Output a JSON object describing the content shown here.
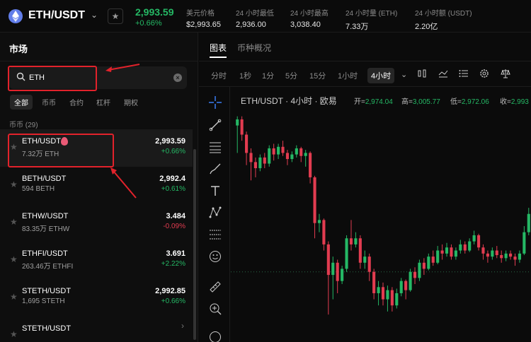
{
  "header": {
    "pair": "ETH/USDT",
    "price": "2,993.59",
    "change": "+0.66%",
    "stats": [
      {
        "label": "美元价格",
        "value": "$2,993.65"
      },
      {
        "label": "24 小时最低",
        "value": "2,936.00"
      },
      {
        "label": "24 小时最高",
        "value": "3,038.40"
      },
      {
        "label": "24 小时量 (ETH)",
        "value": "7.33万"
      },
      {
        "label": "24 小时额 (USDT)",
        "value": "2.20亿"
      }
    ]
  },
  "market": {
    "title": "市场",
    "search": {
      "value": "ETH",
      "placeholder": ""
    },
    "filters": [
      "全部",
      "币币",
      "合约",
      "杠杆",
      "期权"
    ],
    "group_label": "币币 (29)",
    "rows": [
      {
        "symbol": "ETH/USDT",
        "volume": "7.32万 ETH",
        "price": "2,993.59",
        "change": "+0.66%",
        "dir": "up"
      },
      {
        "symbol": "BETH/USDT",
        "volume": "594 BETH",
        "price": "2,992.4",
        "change": "+0.61%",
        "dir": "up"
      },
      {
        "symbol": "ETHW/USDT",
        "volume": "83.35万 ETHW",
        "price": "3.484",
        "change": "-0.09%",
        "dir": "down"
      },
      {
        "symbol": "ETHFI/USDT",
        "volume": "263.46万 ETHFI",
        "price": "3.691",
        "change": "+2.22%",
        "dir": "up"
      },
      {
        "symbol": "STETH/USDT",
        "volume": "1,695 STETH",
        "price": "2,992.85",
        "change": "+0.66%",
        "dir": "up"
      },
      {
        "symbol": "STETH/USDT",
        "volume": "",
        "price": "",
        "change": "",
        "dir": "up"
      }
    ]
  },
  "chart_panel": {
    "tabs": [
      "图表",
      "币种概况"
    ],
    "timeframes": [
      "分时",
      "1秒",
      "1分",
      "5分",
      "15分",
      "1小时",
      "4小时"
    ],
    "active_timeframe": "4小时",
    "title": "ETH/USDT · 4小时 · 欧易",
    "ohlc": {
      "open_label": "开=",
      "open": "2,974.04",
      "high_label": "高=",
      "high": "3,005.77",
      "low_label": "低=",
      "low": "2,972.06",
      "close_label": "收=",
      "close": "2,993"
    }
  },
  "colors": {
    "up": "#25b865",
    "down": "#e23c50",
    "accent": "#e2222b",
    "background": "#0b0b0b"
  },
  "chart_data": {
    "type": "candlestick",
    "series": [
      {
        "o": 3470,
        "c": 3490,
        "h": 3500,
        "l": 3380
      },
      {
        "o": 3490,
        "c": 3440,
        "h": 3500,
        "l": 3420
      },
      {
        "o": 3440,
        "c": 3380,
        "h": 3450,
        "l": 3340
      },
      {
        "o": 3380,
        "c": 3350,
        "h": 3395,
        "l": 3290
      },
      {
        "o": 3350,
        "c": 3330,
        "h": 3365,
        "l": 3300
      },
      {
        "o": 3330,
        "c": 3365,
        "h": 3375,
        "l": 3320
      },
      {
        "o": 3365,
        "c": 3345,
        "h": 3380,
        "l": 3330
      },
      {
        "o": 3345,
        "c": 3395,
        "h": 3405,
        "l": 3335
      },
      {
        "o": 3395,
        "c": 3375,
        "h": 3410,
        "l": 3355
      },
      {
        "o": 3375,
        "c": 3400,
        "h": 3410,
        "l": 3360
      },
      {
        "o": 3400,
        "c": 3380,
        "h": 3420,
        "l": 3370
      },
      {
        "o": 3380,
        "c": 3360,
        "h": 3390,
        "l": 3340
      },
      {
        "o": 3360,
        "c": 3375,
        "h": 3385,
        "l": 3350
      },
      {
        "o": 3375,
        "c": 3395,
        "h": 3405,
        "l": 3365
      },
      {
        "o": 3395,
        "c": 3370,
        "h": 3400,
        "l": 3350
      },
      {
        "o": 3370,
        "c": 3380,
        "h": 3390,
        "l": 3335
      },
      {
        "o": 3380,
        "c": 3300,
        "h": 3385,
        "l": 3280
      },
      {
        "o": 3300,
        "c": 3150,
        "h": 3305,
        "l": 3100
      },
      {
        "o": 3150,
        "c": 3160,
        "h": 3180,
        "l": 3120
      },
      {
        "o": 3160,
        "c": 3080,
        "h": 3165,
        "l": 3060
      },
      {
        "o": 3080,
        "c": 2980,
        "h": 3090,
        "l": 2850
      },
      {
        "o": 2980,
        "c": 3020,
        "h": 3040,
        "l": 2900
      },
      {
        "o": 3020,
        "c": 2960,
        "h": 3030,
        "l": 2920
      },
      {
        "o": 2960,
        "c": 3000,
        "h": 3010,
        "l": 2950
      },
      {
        "o": 3000,
        "c": 3100,
        "h": 3110,
        "l": 2990
      },
      {
        "o": 3100,
        "c": 3080,
        "h": 3160,
        "l": 3060
      },
      {
        "o": 3080,
        "c": 3100,
        "h": 3120,
        "l": 3070
      },
      {
        "o": 3100,
        "c": 3020,
        "h": 3110,
        "l": 3000
      },
      {
        "o": 3020,
        "c": 3040,
        "h": 3060,
        "l": 3000
      },
      {
        "o": 3040,
        "c": 2990,
        "h": 3050,
        "l": 2960
      },
      {
        "o": 2990,
        "c": 2920,
        "h": 3000,
        "l": 2900
      },
      {
        "o": 2920,
        "c": 2940,
        "h": 2960,
        "l": 2880
      },
      {
        "o": 2940,
        "c": 2900,
        "h": 2955,
        "l": 2880
      },
      {
        "o": 2900,
        "c": 2930,
        "h": 2945,
        "l": 2860
      },
      {
        "o": 2930,
        "c": 2880,
        "h": 2940,
        "l": 2860
      },
      {
        "o": 2880,
        "c": 2920,
        "h": 2935,
        "l": 2870
      },
      {
        "o": 2920,
        "c": 2960,
        "h": 2970,
        "l": 2910
      },
      {
        "o": 2960,
        "c": 2930,
        "h": 2965,
        "l": 2900
      },
      {
        "o": 2930,
        "c": 2990,
        "h": 3000,
        "l": 2925
      },
      {
        "o": 2990,
        "c": 2970,
        "h": 3005,
        "l": 2950
      },
      {
        "o": 2970,
        "c": 3020,
        "h": 3030,
        "l": 2960
      },
      {
        "o": 3020,
        "c": 3000,
        "h": 3035,
        "l": 2980
      },
      {
        "o": 3000,
        "c": 3040,
        "h": 3050,
        "l": 2995
      },
      {
        "o": 3040,
        "c": 3020,
        "h": 3060,
        "l": 3010
      },
      {
        "o": 3020,
        "c": 3060,
        "h": 3075,
        "l": 3015
      },
      {
        "o": 3060,
        "c": 3050,
        "h": 3080,
        "l": 3030
      },
      {
        "o": 3050,
        "c": 3070,
        "h": 3085,
        "l": 3040
      },
      {
        "o": 3070,
        "c": 3040,
        "h": 3080,
        "l": 3030
      },
      {
        "o": 3040,
        "c": 3060,
        "h": 3070,
        "l": 3030
      },
      {
        "o": 3060,
        "c": 3080,
        "h": 3095,
        "l": 3050
      },
      {
        "o": 3080,
        "c": 3060,
        "h": 3090,
        "l": 3050
      },
      {
        "o": 3060,
        "c": 3090,
        "h": 3100,
        "l": 3055
      },
      {
        "o": 3090,
        "c": 3110,
        "h": 3125,
        "l": 3080
      },
      {
        "o": 3110,
        "c": 3070,
        "h": 3115,
        "l": 3060
      },
      {
        "o": 3070,
        "c": 3050,
        "h": 3080,
        "l": 3030
      },
      {
        "o": 3050,
        "c": 3040,
        "h": 3060,
        "l": 3020
      },
      {
        "o": 3040,
        "c": 3060,
        "h": 3070,
        "l": 3030
      },
      {
        "o": 3060,
        "c": 3045,
        "h": 3075,
        "l": 3035
      },
      {
        "o": 3045,
        "c": 3035,
        "h": 3060,
        "l": 3020
      },
      {
        "o": 3035,
        "c": 3050,
        "h": 3060,
        "l": 3025
      },
      {
        "o": 3050,
        "c": 3040,
        "h": 3060,
        "l": 3030
      },
      {
        "o": 3040,
        "c": 3030,
        "h": 3050,
        "l": 3010
      },
      {
        "o": 3030,
        "c": 3050,
        "h": 3060,
        "l": 3020
      },
      {
        "o": 3050,
        "c": 3120,
        "h": 3140,
        "l": 3045
      },
      {
        "o": 3120,
        "c": 3180,
        "h": 3200,
        "l": 3110
      }
    ],
    "ylim": [
      2760,
      3520
    ]
  }
}
